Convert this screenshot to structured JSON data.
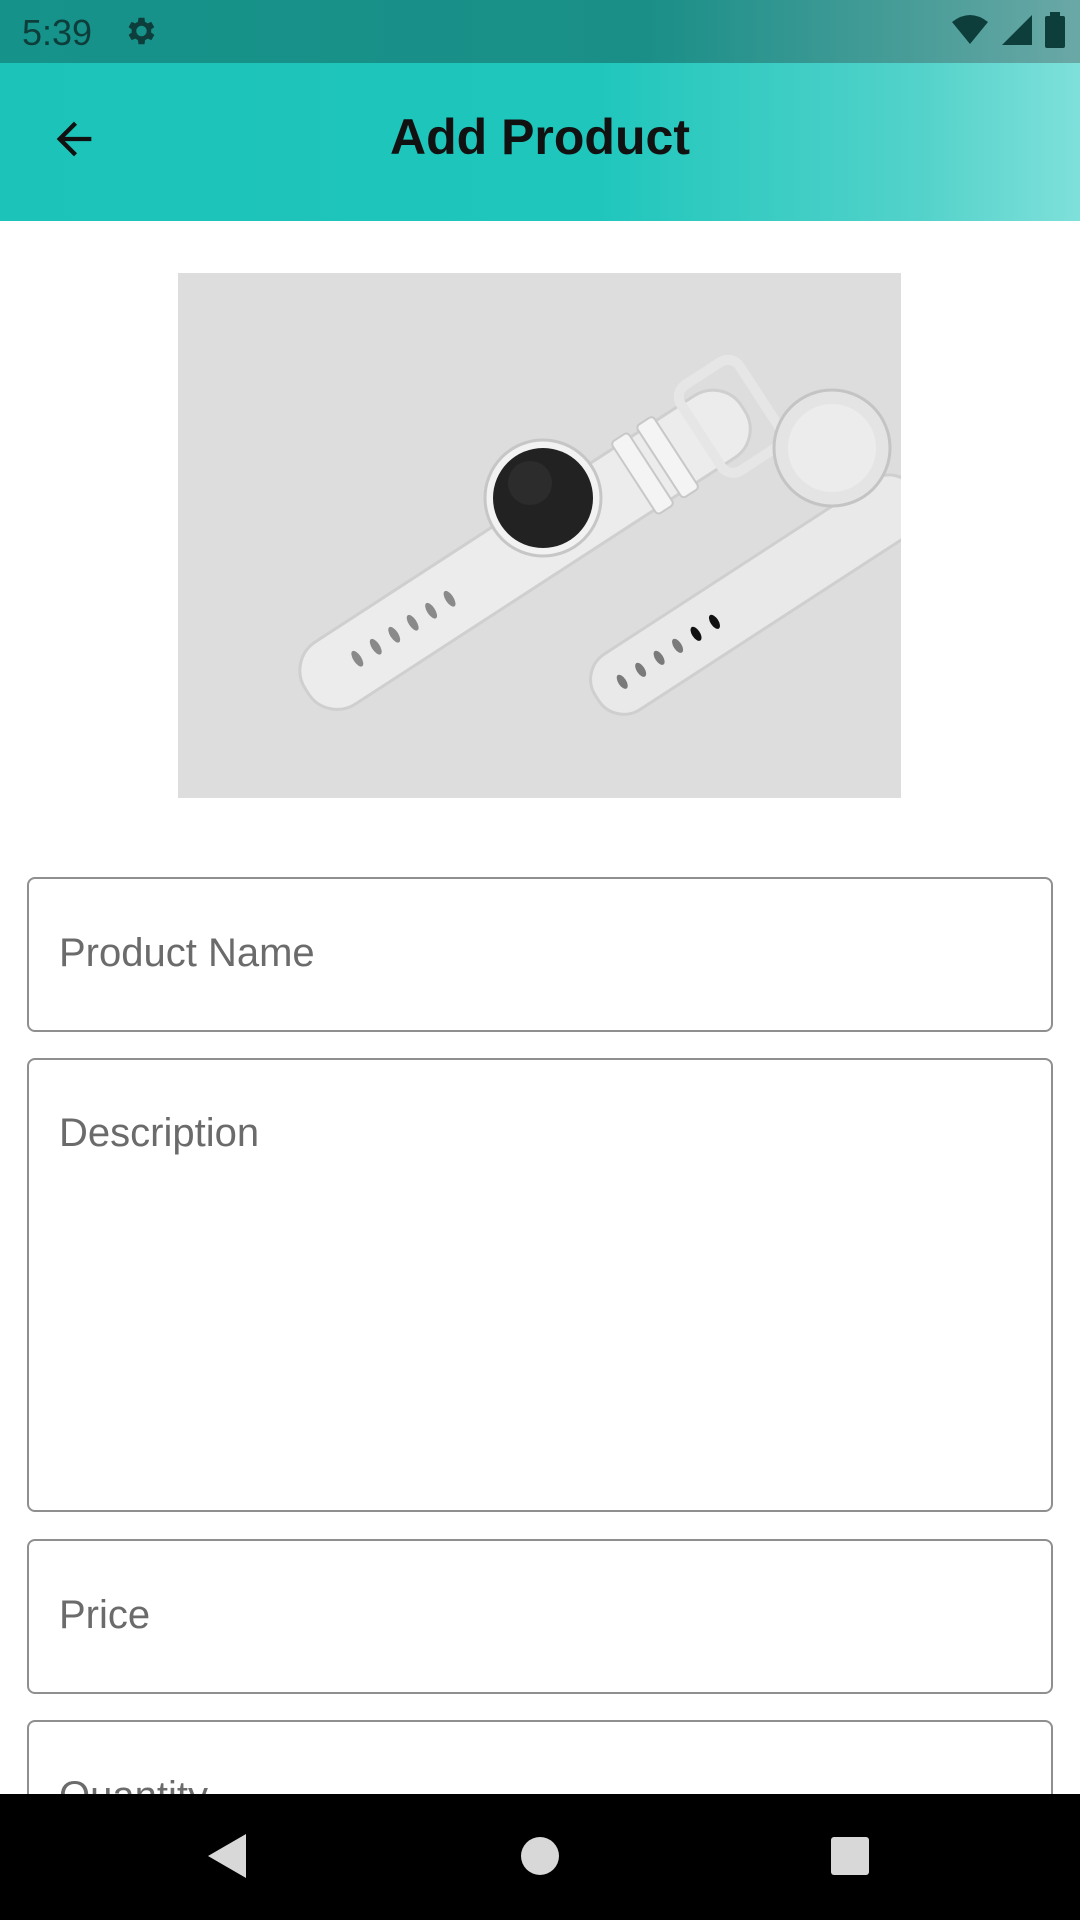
{
  "status_bar": {
    "time": "5:39",
    "icons": [
      "gear-icon",
      "wifi-icon",
      "cellular-signal-icon",
      "battery-icon"
    ]
  },
  "app_bar": {
    "title": "Add Product",
    "back_icon": "arrow-left-icon",
    "background_colors": [
      "#1cc3b9",
      "#7fe0da"
    ]
  },
  "product_image": {
    "description_icon": "smartwatch-product-photo"
  },
  "form": {
    "product_name": {
      "placeholder": "Product Name",
      "value": ""
    },
    "description": {
      "placeholder": "Description",
      "value": ""
    },
    "price": {
      "placeholder": "Price",
      "value": ""
    },
    "quantity": {
      "placeholder": "Quantity",
      "value": ""
    }
  },
  "nav_bar": {
    "icons": [
      "back-triangle-icon",
      "home-circle-icon",
      "recents-square-icon"
    ]
  }
}
